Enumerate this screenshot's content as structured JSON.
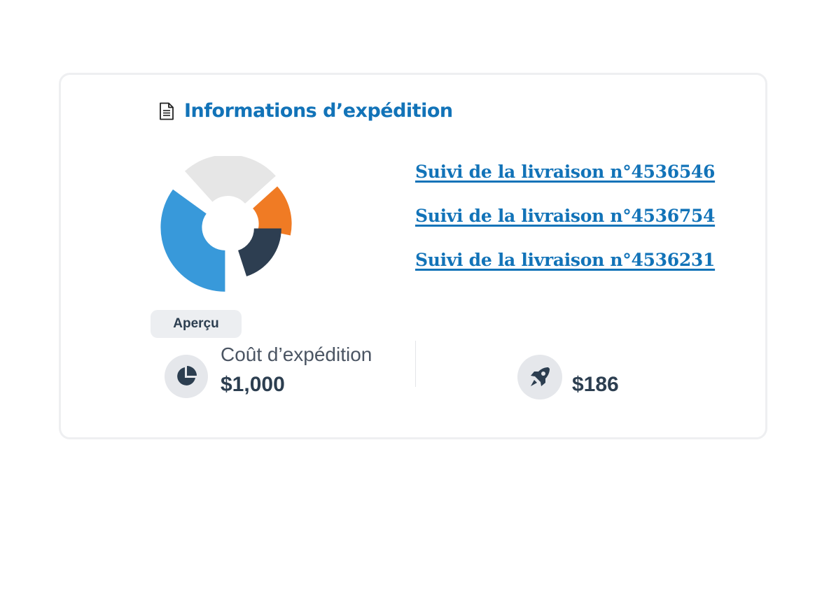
{
  "header": {
    "title": "Informations d’expédition",
    "icon": "document-icon"
  },
  "chart_data": {
    "type": "pie",
    "title": "",
    "categories": [
      "",
      "",
      "",
      ""
    ],
    "values": [
      25,
      15,
      20,
      35
    ],
    "colors": [
      "#e6e6e6",
      "#f07b24",
      "#2d3e51",
      "#3899da"
    ]
  },
  "links": [
    {
      "label": "Suivi de la livraison n°4536546"
    },
    {
      "label": "Suivi de la livraison n°4536754"
    },
    {
      "label": "Suivi de la livraison n°4536231"
    }
  ],
  "badge": {
    "label": "Aperçu"
  },
  "stats": {
    "shipping": {
      "label": "Coût d’expédition",
      "value": "$1,000",
      "icon": "pie-chart-icon"
    },
    "other": {
      "value": "$186",
      "icon": "rocket-icon"
    }
  }
}
